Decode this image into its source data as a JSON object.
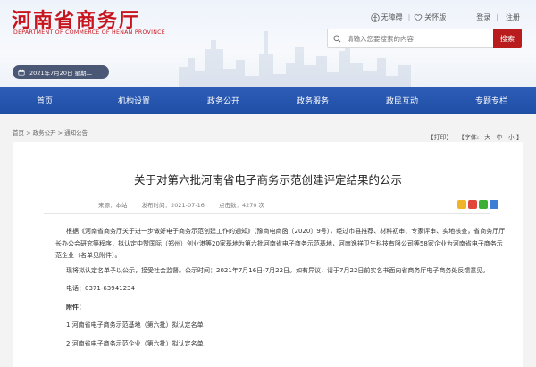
{
  "header": {
    "logo_cn": "河南省商务厅",
    "logo_en": "DEPARTMENT OF COMMERCE OF HENAN PROVINCE",
    "toplinks": [
      "无障碍",
      "关怀版",
      "登录",
      "注册"
    ],
    "search_placeholder": "请输入您要搜索的内容",
    "search_button": "搜索",
    "date": "2021年7月20日 星期二"
  },
  "nav": {
    "items": [
      "首页",
      "机构设置",
      "政务公开",
      "政务服务",
      "政民互动",
      "专题专栏"
    ]
  },
  "breadcrumb": "首页 > 政务公开 > 通知公告",
  "tools": {
    "print": "【打印】",
    "font_label": "【字体:",
    "large": "大",
    "medium": "中",
    "small": "小",
    "close": "】"
  },
  "article": {
    "title": "关于对第六批河南省电子商务示范创建评定结果的公示",
    "source": "来源：本站",
    "date": "发布时间：2021-07-16",
    "views": "点击数：4270 次",
    "para1": "根据《河南省商务厅关于进一步做好电子商务示范创建工作的通知》（豫商电商函〔2020〕9号），经过市县推荐、材料初审、专家评审、实地核查，省商务厅厅长办公会研究等程序，拟认定中赞国际（郑州）创业港等20家基地为第六批河南省电子商务示范基地，河南逸祥卫生科技有限公司等58家企业为河南省电子商务示范企业（名单见附件）。",
    "para2": "现将拟认定名单予以公示，接受社会监督。公示时间：2021年7月16日-7月22日。如有异议，请于7月22日前实名书面向省商务厅电子商务处反馈意见。",
    "phone": "电话：0371-63941234",
    "attachment_label": "附件：",
    "attachment1": "1.河南省电子商务示范基地（第六批）拟认定名单",
    "attachment2": "2.河南省电子商务示范企业（第六批）拟认定名单"
  },
  "colors": {
    "brand_red": "#c8151d",
    "nav_blue": "#2455ad",
    "search_red": "#b91c1c"
  }
}
